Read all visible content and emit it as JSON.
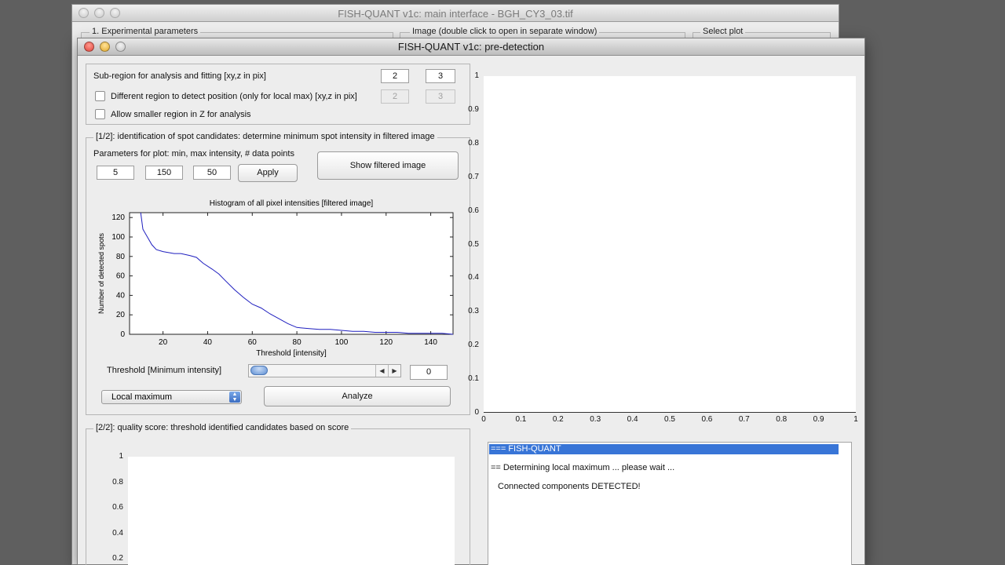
{
  "main_window": {
    "title": "FISH-QUANT v1c: main interface - BGH_CY3_03.tif",
    "panel_experimental": "1. Experimental parameters",
    "panel_image": "Image (double click to open in separate window)",
    "panel_select_plot": "Select plot"
  },
  "window": {
    "title": "FISH-QUANT v1c: pre-detection"
  },
  "subregion": {
    "label": "Sub-region for analysis and fitting [xy,z in pix]",
    "xy_value": "2",
    "z_value": "3",
    "diff_region_label": "Different region to detect position (only for local max) [xy,z in pix]",
    "diff_xy_value": "2",
    "diff_z_value": "3",
    "smaller_z_label": "Allow smaller region in Z for analysis"
  },
  "detection": {
    "panel_title": "[1/2]: identification of spot candidates: determine minimum spot intensity in filtered image",
    "plot_params_label": "Parameters for plot: min, max intensity, # data points",
    "min_value": "5",
    "max_value": "150",
    "points_value": "50",
    "apply_label": "Apply",
    "show_filtered_label": "Show filtered image",
    "threshold_label": "Threshold [Minimum intensity]",
    "threshold_value": "0",
    "threshold_level": 0,
    "method_selected": "Local maximum",
    "analyze_label": "Analyze"
  },
  "quality": {
    "panel_title": "[2/2]: quality score: threshold identified candidates based on score",
    "y_ticks": [
      "1",
      "0.8",
      "0.6",
      "0.4",
      "0.2"
    ]
  },
  "main_axes": {
    "y_ticks": [
      "1",
      "0.9",
      "0.8",
      "0.7",
      "0.6",
      "0.5",
      "0.4",
      "0.3",
      "0.2",
      "0.1",
      "0"
    ],
    "x_ticks": [
      "0",
      "0.1",
      "0.2",
      "0.3",
      "0.4",
      "0.5",
      "0.6",
      "0.7",
      "0.8",
      "0.9",
      "1"
    ]
  },
  "log": {
    "lines": [
      "=== FISH-QUANT",
      "== Determining local maximum ... please wait ...",
      "Connected components DETECTED!"
    ]
  },
  "chart_data": {
    "type": "line",
    "title": "Histogram of all pixel intensities [filtered image]",
    "xlabel": "Threshold [intensity]",
    "ylabel": "Number of detected spots",
    "xlim": [
      5,
      150
    ],
    "ylim": [
      0,
      125
    ],
    "x_ticks": [
      "20",
      "40",
      "60",
      "80",
      "100",
      "120",
      "140"
    ],
    "y_ticks": [
      "0",
      "20",
      "40",
      "60",
      "80",
      "100",
      "120"
    ],
    "grid": false,
    "color": "#1f1fbf",
    "series": [
      {
        "x": [
          10,
          11,
          13,
          15,
          17,
          20,
          25,
          28,
          32,
          35,
          38,
          42,
          45,
          48,
          52,
          56,
          60,
          64,
          68,
          72,
          76,
          80,
          85,
          90,
          95,
          100,
          105,
          110,
          115,
          120,
          125,
          130,
          135,
          140,
          145,
          150
        ],
        "y": [
          125,
          108,
          100,
          92,
          87,
          85,
          83,
          83,
          81,
          79,
          73,
          67,
          62,
          55,
          46,
          38,
          31,
          27,
          21,
          16,
          11,
          7,
          6,
          5,
          5,
          4,
          3,
          3,
          2,
          2,
          2,
          1,
          1,
          1,
          1,
          0
        ]
      }
    ]
  }
}
